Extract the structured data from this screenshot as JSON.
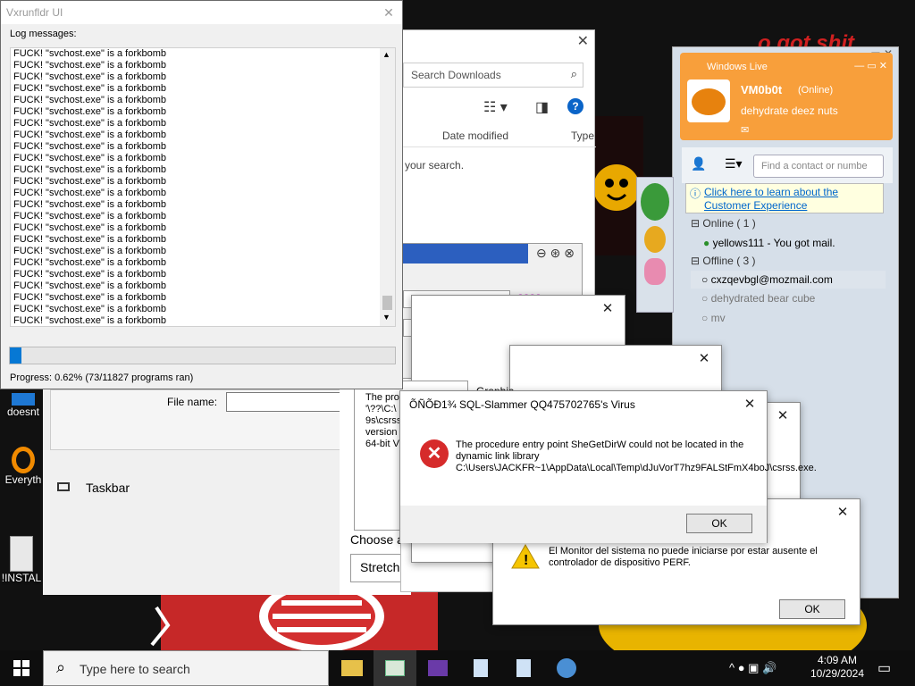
{
  "vxrunfldr": {
    "title": "Vxrunfldr UI",
    "log_label": "Log messages:",
    "log_lines": [
      "FUCK! \"svchost.exe\" is a forkbomb",
      "FUCK! \"svchost.exe\" is a forkbomb",
      "FUCK! \"svchost.exe\" is a forkbomb",
      "FUCK! \"svchost.exe\" is a forkbomb",
      "FUCK! \"svchost.exe\" is a forkbomb",
      "FUCK! \"svchost.exe\" is a forkbomb",
      "FUCK! \"svchost.exe\" is a forkbomb",
      "FUCK! \"svchost.exe\" is a forkbomb",
      "FUCK! \"svchost.exe\" is a forkbomb",
      "FUCK! \"svchost.exe\" is a forkbomb",
      "FUCK! \"svchost.exe\" is a forkbomb",
      "FUCK! \"svchost.exe\" is a forkbomb",
      "FUCK! \"svchost.exe\" is a forkbomb",
      "FUCK! \"svchost.exe\" is a forkbomb",
      "FUCK! \"svchost.exe\" is a forkbomb",
      "FUCK! \"svchost.exe\" is a forkbomb",
      "FUCK! \"svchost.exe\" is a forkbomb",
      "FUCK! \"svchost.exe\" is a forkbomb",
      "FUCK! \"svchost.exe\" is a forkbomb",
      "FUCK! \"svchost.exe\" is a forkbomb",
      "FUCK! \"svchost.exe\" is a forkbomb",
      "FUCK! \"svchost.exe\" is a forkbomb",
      "FUCK! \"svchost.exe\" is a forkbomb",
      "FUCK! \"svchost.exe\" is a forkbomb"
    ],
    "progress_fraction": 0.0062,
    "progress_text": "Progress: 0.62% (73/11827 programs ran)"
  },
  "downloads": {
    "search_placeholder": "Search Downloads",
    "col_date": "Date modified",
    "col_type": "Type",
    "empty_text": "your search."
  },
  "settings_bg": {
    "file_name_label": "File name:",
    "taskbar_label": "Taskbar",
    "choose_label": "Choose a",
    "fit_value": "Stretch"
  },
  "chinese_dlg": {
    "q1": "????",
    "q2": "????",
    "check_label": "????",
    "btn1": "??",
    "btn2": "??"
  },
  "partial_dlg": {
    "lines": [
      "The pro",
      "'\\??\\C:\\",
      "9s\\csrss",
      "version",
      "64-bit V"
    ],
    "graphic_label": "Graphic"
  },
  "error_dlg": {
    "title": "ÕÑÕÐ1¾ SQL-Slammer QQ475702765's Virus",
    "message": "The procedure entry point SheGetDirW could not be located in the dynamic link library C:\\Users\\JACKFR~1\\AppData\\Local\\Temp\\dJuVorT7hz9FALStFmX4boJ\\csrss.exe.",
    "ok": "OK"
  },
  "monitor_dlg": {
    "message": "El Monitor del sistema no puede iniciarse por estar ausente el controlador de dispositivo PERF.",
    "ok": "OK"
  },
  "msn": {
    "title": "Windows Live",
    "user": "VM0b0t",
    "status": "(Online)",
    "personal": "dehydrate deez nuts",
    "search_placeholder": "Find a contact or numbe",
    "ad_link": "Click here to learn about the Customer Experience",
    "online_group": "Online ( 1 )",
    "online_contacts": [
      "yellows111 - You got mail."
    ],
    "offline_group": "Offline ( 3 )",
    "offline_contacts": [
      "cxzqevbgl@mozmail.com",
      "dehydrated bear cube",
      "mv"
    ],
    "wallpaper_text": "o got shit"
  },
  "desktop_icons": [
    "doesnt",
    "Everyth",
    "!INSTAL"
  ],
  "taskbar": {
    "search_placeholder": "Type here to search",
    "time": "4:09 AM",
    "date": "10/29/2024"
  }
}
